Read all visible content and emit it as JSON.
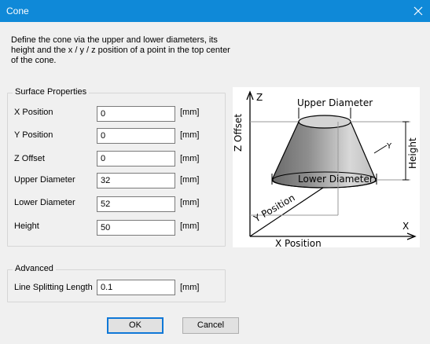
{
  "window": {
    "title": "Cone",
    "close_icon": "close-icon"
  },
  "description": "Define the cone via the upper and lower diameters, its height and the x / y / z position of a point in the top center of the cone.",
  "surface": {
    "title": "Surface Properties",
    "fields": [
      {
        "label": "X Position",
        "value": "0",
        "unit": "[mm]"
      },
      {
        "label": "Y Position",
        "value": "0",
        "unit": "[mm]"
      },
      {
        "label": "Z Offset",
        "value": "0",
        "unit": "[mm]"
      },
      {
        "label": "Upper Diameter",
        "value": "32",
        "unit": "[mm]"
      },
      {
        "label": "Lower Diameter",
        "value": "52",
        "unit": "[mm]"
      },
      {
        "label": "Height",
        "value": "50",
        "unit": "[mm]"
      }
    ]
  },
  "advanced": {
    "title": "Advanced",
    "field": {
      "label": "Line Splitting Length",
      "value": "0.1",
      "unit": "[mm]"
    }
  },
  "diagram": {
    "z_axis": "Z",
    "x_axis": "X",
    "z_offset": "Z Offset",
    "upper_diameter": "Upper Diameter",
    "lower_diameter": "Lower Diameter",
    "height": "Height",
    "y_small": "Y",
    "y_position": "Y Position",
    "x_position": "X Position"
  },
  "buttons": {
    "ok": "OK",
    "cancel": "Cancel"
  }
}
